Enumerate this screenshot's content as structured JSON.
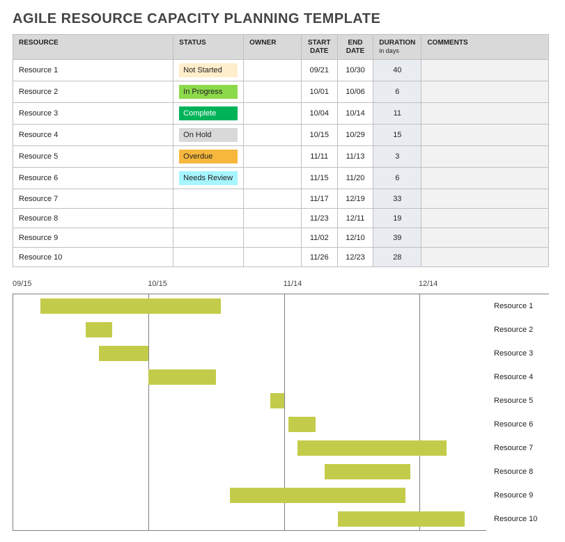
{
  "title": "AGILE RESOURCE CAPACITY PLANNING TEMPLATE",
  "headers": {
    "resource": "RESOURCE",
    "status": "STATUS",
    "owner": "OWNER",
    "start": "START DATE",
    "end": "END DATE",
    "duration": "DURATION",
    "duration_sub": "in days",
    "comments": "COMMENTS"
  },
  "status_styles": {
    "Not Started": "st-not",
    "In Progress": "st-prog",
    "Complete": "st-done",
    "On Hold": "st-hold",
    "Overdue": "st-over",
    "Needs Review": "st-review"
  },
  "rows": [
    {
      "resource": "Resource 1",
      "status": "Not Started",
      "owner": "",
      "start": "09/21",
      "end": "10/30",
      "duration": "40",
      "comments": ""
    },
    {
      "resource": "Resource 2",
      "status": "In Progress",
      "owner": "",
      "start": "10/01",
      "end": "10/06",
      "duration": "6",
      "comments": ""
    },
    {
      "resource": "Resource 3",
      "status": "Complete",
      "owner": "",
      "start": "10/04",
      "end": "10/14",
      "duration": "11",
      "comments": ""
    },
    {
      "resource": "Resource 4",
      "status": "On Hold",
      "owner": "",
      "start": "10/15",
      "end": "10/29",
      "duration": "15",
      "comments": ""
    },
    {
      "resource": "Resource 5",
      "status": "Overdue",
      "owner": "",
      "start": "11/11",
      "end": "11/13",
      "duration": "3",
      "comments": ""
    },
    {
      "resource": "Resource 6",
      "status": "Needs Review",
      "owner": "",
      "start": "11/15",
      "end": "11/20",
      "duration": "6",
      "comments": ""
    },
    {
      "resource": "Resource 7",
      "status": "",
      "owner": "",
      "start": "11/17",
      "end": "12/19",
      "duration": "33",
      "comments": ""
    },
    {
      "resource": "Resource 8",
      "status": "",
      "owner": "",
      "start": "11/23",
      "end": "12/11",
      "duration": "19",
      "comments": ""
    },
    {
      "resource": "Resource 9",
      "status": "",
      "owner": "",
      "start": "11/02",
      "end": "12/10",
      "duration": "39",
      "comments": ""
    },
    {
      "resource": "Resource 10",
      "status": "",
      "owner": "",
      "start": "11/26",
      "end": "12/23",
      "duration": "28",
      "comments": ""
    }
  ],
  "chart_data": {
    "type": "bar",
    "orientation": "horizontal-gantt",
    "x_ticks": [
      "09/15",
      "10/15",
      "11/14",
      "12/14"
    ],
    "series": [
      {
        "name": "Resource 1",
        "start": "09/21",
        "end": "10/30"
      },
      {
        "name": "Resource 2",
        "start": "10/01",
        "end": "10/06"
      },
      {
        "name": "Resource 3",
        "start": "10/04",
        "end": "10/14"
      },
      {
        "name": "Resource 4",
        "start": "10/15",
        "end": "10/29"
      },
      {
        "name": "Resource 5",
        "start": "11/11",
        "end": "11/13"
      },
      {
        "name": "Resource 6",
        "start": "11/15",
        "end": "11/20"
      },
      {
        "name": "Resource 7",
        "start": "11/17",
        "end": "12/19"
      },
      {
        "name": "Resource 8",
        "start": "11/23",
        "end": "12/11"
      },
      {
        "name": "Resource 9",
        "start": "11/02",
        "end": "12/10"
      },
      {
        "name": "Resource 10",
        "start": "11/26",
        "end": "12/23"
      }
    ],
    "bar_color": "#c3cc4a",
    "axis_range": {
      "start": "09/15",
      "end": "12/29"
    }
  }
}
